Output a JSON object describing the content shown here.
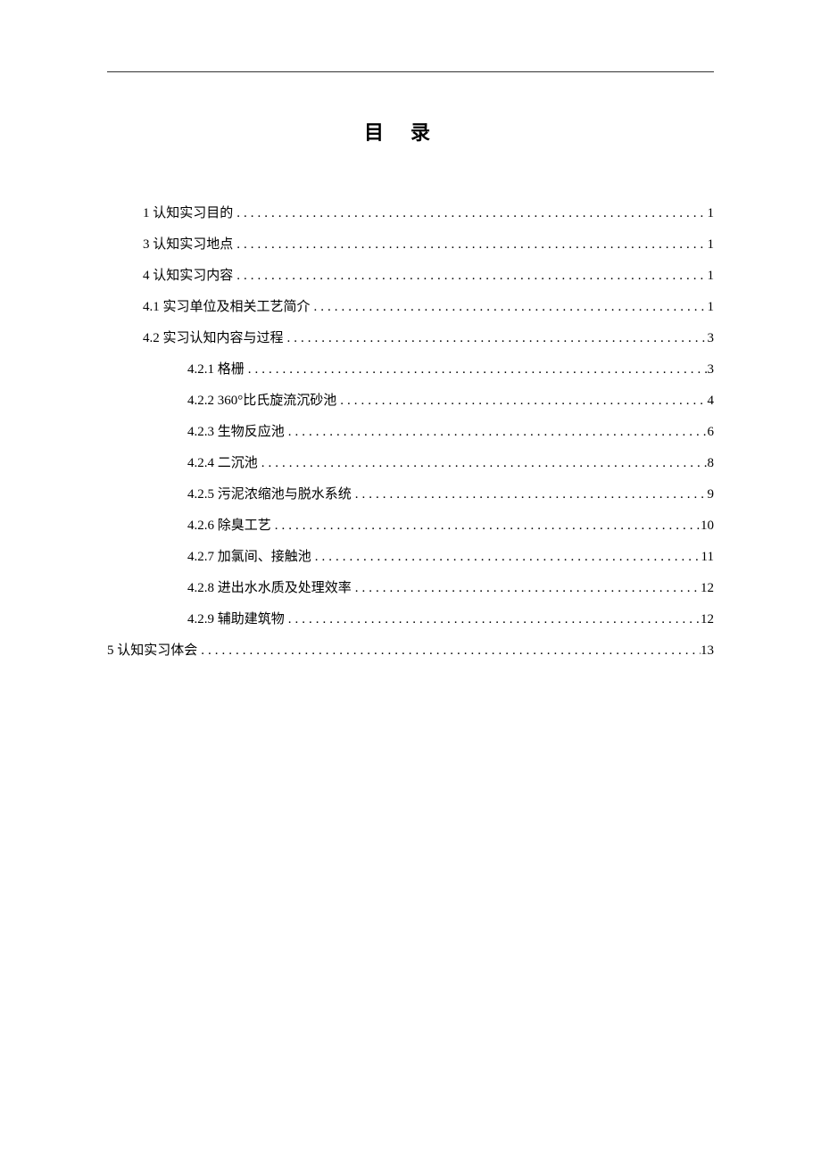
{
  "title": "目录",
  "toc": [
    {
      "level": "level-1",
      "label": "1 认知实习目的",
      "page": "1"
    },
    {
      "level": "level-1",
      "label": "3 认知实习地点",
      "page": "1"
    },
    {
      "level": "level-1",
      "label": "4 认知实习内容",
      "page": "1"
    },
    {
      "level": "level-2",
      "label": "4.1 实习单位及相关工艺简介",
      "page": "1"
    },
    {
      "level": "level-2",
      "label": "4.2 实习认知内容与过程",
      "page": "3"
    },
    {
      "level": "level-3",
      "label": "4.2.1 格栅",
      "page": "3"
    },
    {
      "level": "level-3",
      "label": "4.2.2 360°比氏旋流沉砂池",
      "page": "4"
    },
    {
      "level": "level-3",
      "label": "4.2.3 生物反应池",
      "page": "6"
    },
    {
      "level": "level-3",
      "label": "4.2.4 二沉池",
      "page": "8"
    },
    {
      "level": "level-3",
      "label": "4.2.5 污泥浓缩池与脱水系统",
      "page": "9"
    },
    {
      "level": "level-3",
      "label": "4.2.6 除臭工艺",
      "page": "10"
    },
    {
      "level": "level-3",
      "label": "4.2.7 加氯间、接触池",
      "page": "11"
    },
    {
      "level": "level-3",
      "label": "4.2.8 进出水水质及处理效率",
      "page": "12"
    },
    {
      "level": "level-3",
      "label": "4.2.9 辅助建筑物",
      "page": "12"
    },
    {
      "level": "level-0",
      "label": "5 认知实习体会",
      "page": "13"
    }
  ]
}
